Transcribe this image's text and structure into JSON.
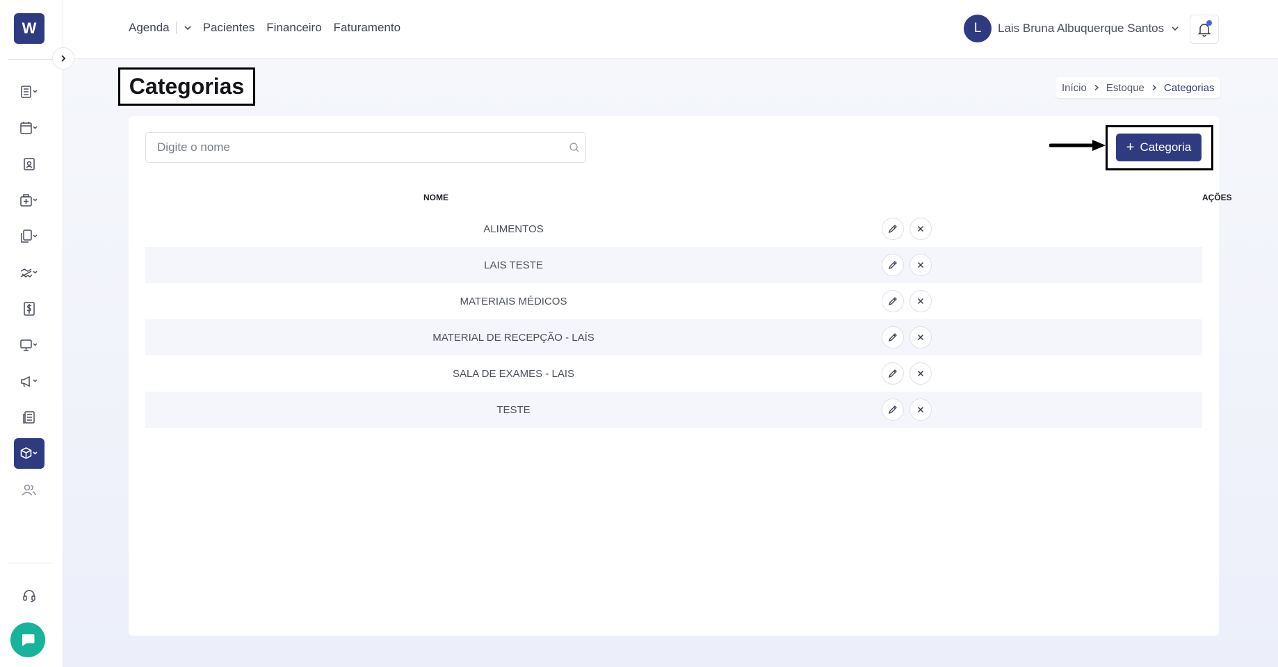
{
  "app": {
    "logo_letter": "W",
    "brand_color": "#2f3b80",
    "accent_color": "#17b39b"
  },
  "topnav": {
    "items": [
      "Agenda",
      "Pacientes",
      "Financeiro",
      "Faturamento"
    ]
  },
  "user": {
    "initial": "L",
    "name": "Lais Bruna Albuquerque Santos"
  },
  "sidebar": {
    "icons": [
      "list-icon",
      "calendar-icon",
      "patient-card-icon",
      "medical-kit-icon",
      "documents-icon",
      "handshake-icon",
      "dollar-icon",
      "monitor-icon",
      "megaphone-icon",
      "newspaper-icon",
      "box-icon",
      "users-icon"
    ],
    "active": "box-icon",
    "support_icon": "headset-icon",
    "chat_icon": "chat-icon"
  },
  "page": {
    "title": "Categorias"
  },
  "breadcrumb": {
    "items": [
      "Início",
      "Estoque",
      "Categorias"
    ]
  },
  "search": {
    "placeholder": "Digite o nome",
    "value": ""
  },
  "toolbar": {
    "add_label": "Categoria"
  },
  "table": {
    "columns": [
      "NOME",
      "AÇÕES"
    ],
    "rows": [
      {
        "name": "ALIMENTOS"
      },
      {
        "name": "LAIS TESTE"
      },
      {
        "name": "MATERIAIS MÉDICOS"
      },
      {
        "name": "MATERIAL DE RECEPÇÃO - LAÍS"
      },
      {
        "name": "SALA DE EXAMES - LAIS"
      },
      {
        "name": "TESTE"
      }
    ]
  }
}
